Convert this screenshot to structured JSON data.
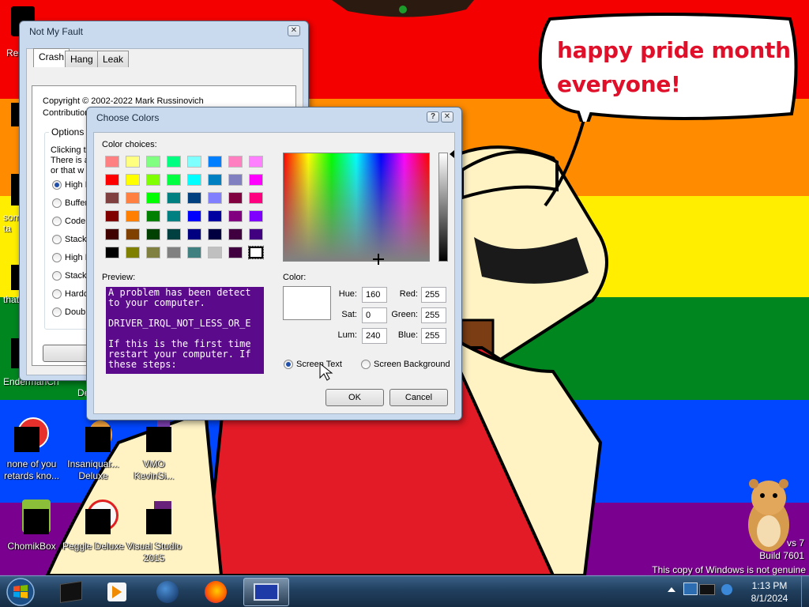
{
  "desktop": {
    "bubble_text_line1": "happy pride month",
    "bubble_text_line2": "everyone!",
    "watermark_line1": "vs 7",
    "watermark_line2": "Build 7601",
    "watermark_line3": "This copy of Windows is not genuine",
    "icons": [
      {
        "label": "none of you retards kno..."
      },
      {
        "label": "Insaniquar... Deluxe"
      },
      {
        "label": "VMO KevinSi..."
      },
      {
        "label": "ChomikBox"
      },
      {
        "label": "Peggle Deluxe"
      },
      {
        "label": "Visual Studio 2015"
      }
    ],
    "edge_labels": [
      "Rec",
      "som ta",
      "that",
      "EndermanCh...",
      "De"
    ],
    "colors": {
      "red": "#f40000",
      "orange": "#ff8b00",
      "yellow": "#ffee00",
      "green": "#00861f",
      "blue": "#0047ff",
      "purple": "#7a0090"
    }
  },
  "not_my_fault": {
    "title": "Not My Fault",
    "close": "✕",
    "tabs": [
      "Crash",
      "Hang",
      "Leak"
    ],
    "copyright_line1": "Copyright © 2002-2022 Mark Russinovich",
    "copyright_line2": "Contributions by Daniel Pearson",
    "options_title": "Options",
    "desc_line1": "Clicking th",
    "desc_line2": "There is a",
    "desc_line3": "or that w",
    "options": [
      {
        "label": "High I",
        "selected": true
      },
      {
        "label": "Buffer",
        "selected": false
      },
      {
        "label": "Code c",
        "selected": false
      },
      {
        "label": "Stack",
        "selected": false
      },
      {
        "label": "High I",
        "selected": false
      },
      {
        "label": "Stack",
        "selected": false
      },
      {
        "label": "Hardco",
        "selected": false
      },
      {
        "label": "Double",
        "selected": false
      }
    ]
  },
  "choose_colors": {
    "title": "Choose Colors",
    "help": "?",
    "close": "✕",
    "color_choices_label": "Color choices:",
    "swatches": [
      "#ff8080",
      "#ffff80",
      "#80ff80",
      "#00ff80",
      "#80ffff",
      "#0080ff",
      "#ff80c0",
      "#ff80ff",
      "#ff0000",
      "#ffff00",
      "#80ff00",
      "#00ff40",
      "#00ffff",
      "#0080c0",
      "#8080c0",
      "#ff00ff",
      "#804040",
      "#ff8040",
      "#00ff00",
      "#008080",
      "#004080",
      "#8080ff",
      "#800040",
      "#ff0080",
      "#800000",
      "#ff8000",
      "#008000",
      "#008080",
      "#0000ff",
      "#0000a0",
      "#800080",
      "#8000ff",
      "#400000",
      "#804000",
      "#004000",
      "#004040",
      "#000080",
      "#000040",
      "#400040",
      "#400080",
      "#000000",
      "#808000",
      "#808040",
      "#808080",
      "#408080",
      "#c0c0c0",
      "#400040",
      "#ffffff"
    ],
    "preview_label": "Preview:",
    "preview_text": "A problem has been detect\nto your computer.\n\nDRIVER_IRQL_NOT_LESS_OR_E\n\nIf this is the first time\nrestart your computer. If\nthese steps:",
    "preview_bg": "#5b0a8c",
    "color_label": "Color:",
    "hue_label": "Hue:",
    "hue": "160",
    "sat_label": "Sat:",
    "sat": "0",
    "lum_label": "Lum:",
    "lum": "240",
    "red_label": "Red:",
    "red": "255",
    "green_label": "Green:",
    "green": "255",
    "blue_label": "Blue:",
    "blue": "255",
    "radio_screen_text": "Screen Text",
    "radio_screen_bg": "Screen Background",
    "ok": "OK",
    "cancel": "Cancel"
  },
  "taskbar": {
    "time": "1:13 PM",
    "date": "8/1/2024"
  }
}
